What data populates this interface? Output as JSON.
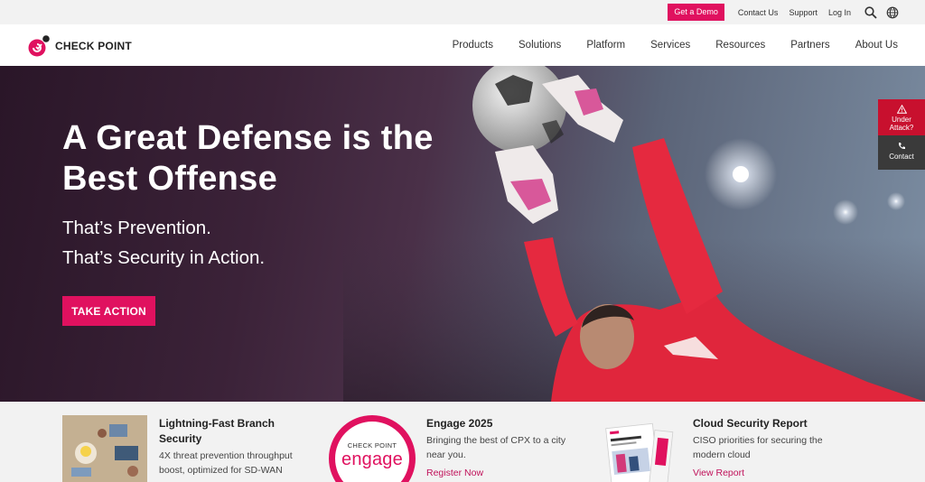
{
  "utility": {
    "demo_label": "Get a Demo",
    "contact_label": "Contact Us",
    "support_label": "Support",
    "login_label": "Log In",
    "search_icon": "search-icon",
    "language_icon": "globe-icon"
  },
  "brand": {
    "logo_text": "CHECK POINT",
    "accent_color": "#e0115f"
  },
  "nav": {
    "items": [
      "Products",
      "Solutions",
      "Platform",
      "Services",
      "Resources",
      "Partners",
      "About Us"
    ]
  },
  "hero": {
    "title_line1": "A Great Defense is the",
    "title_line2": "Best Offense",
    "subtitle_line1": "That’s Prevention.",
    "subtitle_line2": "That’s Security in Action.",
    "cta_label": "TAKE ACTION"
  },
  "side": {
    "attack_label_1": "Under",
    "attack_label_2": "Attack?",
    "contact_label": "Contact"
  },
  "cards": [
    {
      "title_line1": "Lightning-Fast Branch",
      "title_line2": "Security",
      "desc_line1": "4X threat prevention throughput",
      "desc_line2": "boost, optimized for SD-WAN"
    },
    {
      "badge_top": "CHECK POINT",
      "badge_word": "engage",
      "title": "Engage 2025",
      "desc_line1": "Bringing the best of CPX to a city",
      "desc_line2": "near you.",
      "link": "Register Now"
    },
    {
      "title": "Cloud Security Report",
      "desc_line1": "CISO priorities for securing the",
      "desc_line2": "modern cloud",
      "link": "View Report"
    }
  ]
}
